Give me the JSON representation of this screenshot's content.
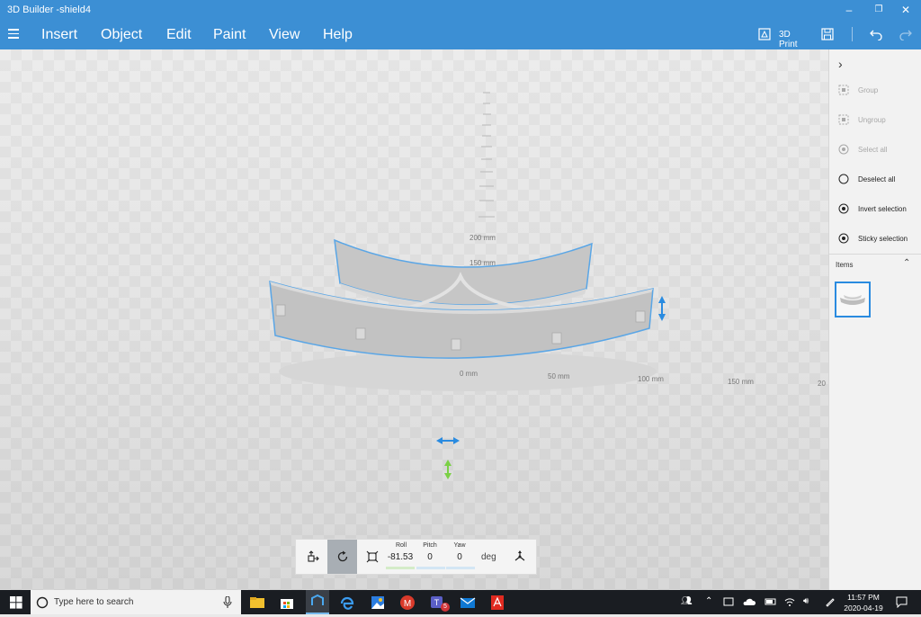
{
  "window": {
    "title": "3D Builder -shield4",
    "minimize_glyph": "–",
    "restore_glyph": "❐",
    "close_glyph": "✕"
  },
  "menu": {
    "items": [
      "Insert",
      "Object",
      "Edit",
      "Paint",
      "View",
      "Help"
    ],
    "print_label": "3D Print"
  },
  "viewport": {
    "axis_labels": {
      "zero": "0 mm",
      "x50": "50 mm",
      "x100": "100 mm",
      "x150": "150 mm",
      "x200": "20",
      "z150": "150 mm",
      "z200": "200 mm"
    }
  },
  "transform": {
    "roll_label": "Roll",
    "pitch_label": "Pitch",
    "yaw_label": "Yaw",
    "roll_value": "-81.53",
    "pitch_value": "0",
    "yaw_value": "0",
    "unit": "deg"
  },
  "panel": {
    "items": [
      {
        "label": "Group",
        "icon": "group-icon",
        "enabled": false
      },
      {
        "label": "Ungroup",
        "icon": "ungroup-icon",
        "enabled": false
      },
      {
        "label": "Select all",
        "icon": "select-all-icon",
        "enabled": false
      },
      {
        "label": "Deselect all",
        "icon": "deselect-all-icon",
        "enabled": true
      },
      {
        "label": "Invert selection",
        "icon": "invert-selection-icon",
        "enabled": true
      },
      {
        "label": "Sticky selection",
        "icon": "sticky-selection-icon",
        "enabled": true
      }
    ],
    "items_heading": "Items"
  },
  "taskbar": {
    "search_placeholder": "Type here to search",
    "time": "11:57 PM",
    "date": "2020-04-19",
    "teams_badge": "5"
  },
  "colors": {
    "accent": "#3c8fd4",
    "selection": "#2a8be0",
    "taskbar": "#1a1d22"
  }
}
